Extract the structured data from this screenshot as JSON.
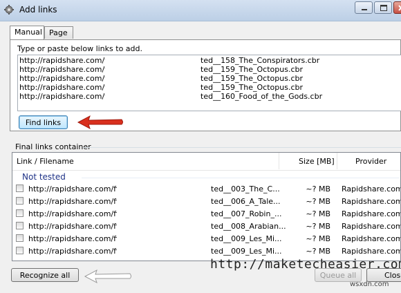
{
  "window": {
    "title": "Add links",
    "icon": "gear-icon"
  },
  "tabs": [
    {
      "label": "Manual",
      "active": true
    },
    {
      "label": "Page",
      "active": false
    }
  ],
  "manual": {
    "instruction": "Type or paste below links to add.",
    "links": [
      {
        "left": "http://rapidshare.com/files",
        "right": "ted__158_The_Conspirators.cbr"
      },
      {
        "left": "http://rapidshare.com/files",
        "right": "ted__159_The_Octopus.cbr"
      },
      {
        "left": "http://rapidshare.com/files",
        "right": "ted__159_The_Octopus.cbr"
      },
      {
        "left": "http://rapidshare.com/files",
        "right": "ted__159_The_Octopus.cbr"
      },
      {
        "left": "http://rapidshare.com/files",
        "right": "ted__160_Food_of_the_Gods.cbr"
      }
    ],
    "find_button": "Find links"
  },
  "final": {
    "label": "Final links container",
    "columns": {
      "link": "Link / Filename",
      "size": "Size [MB]",
      "provider": "Provider"
    },
    "group": "Not tested",
    "rows": [
      {
        "url": "http://rapidshare.com/files/",
        "file": "ted__003_The_C...",
        "size": "~? MB",
        "provider": "Rapidshare.com"
      },
      {
        "url": "http://rapidshare.com/files/",
        "file": "ted__006_A_Tale...",
        "size": "~? MB",
        "provider": "Rapidshare.com"
      },
      {
        "url": "http://rapidshare.com/files/",
        "file": "ted__007_Robin_...",
        "size": "~? MB",
        "provider": "Rapidshare.com"
      },
      {
        "url": "http://rapidshare.com/files/",
        "file": "ted__008_Arabian...",
        "size": "~? MB",
        "provider": "Rapidshare.com"
      },
      {
        "url": "http://rapidshare.com/files/",
        "file": "ted__009_Les_Mi...",
        "size": "~? MB",
        "provider": "Rapidshare.com"
      },
      {
        "url": "http://rapidshare.com/files/",
        "file": "ted__009_Les_Mi...",
        "size": "~? MB",
        "provider": "Rapidshare.com"
      }
    ]
  },
  "buttons": {
    "recognize": "Recognize all",
    "queue": "Queue all",
    "close": "Close"
  },
  "watermark": "http://maketecheasier.com",
  "site_mark": "wsxdn.com",
  "colors": {
    "arrow_red": "#d9301e",
    "arrow_white": "#ffffff",
    "group_text": "#1e3287"
  }
}
